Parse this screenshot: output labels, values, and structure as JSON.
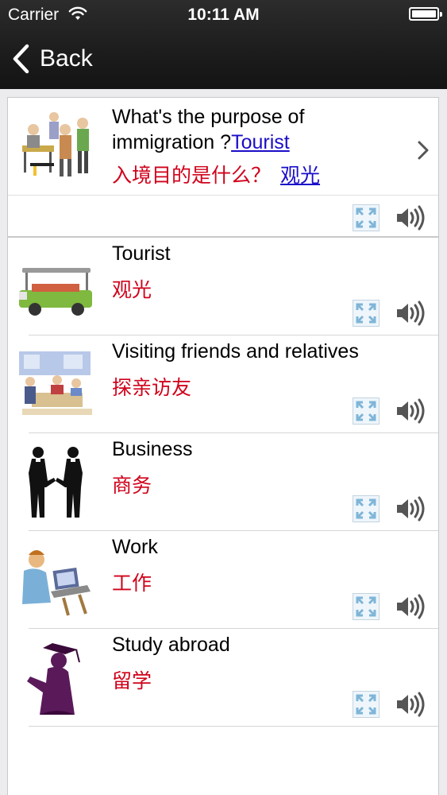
{
  "status_bar": {
    "carrier": "Carrier",
    "time": "10:11 AM"
  },
  "nav": {
    "back_label": "Back"
  },
  "header": {
    "question_en": "What's the purpose of immigration ?",
    "answer_en": "Tourist",
    "question_zh": "入境目的是什么？",
    "answer_zh": "观光"
  },
  "items": [
    {
      "en": "Tourist",
      "zh": "观光",
      "image": "tourist-bus-image"
    },
    {
      "en": "Visiting friends and relatives",
      "zh": "探亲访友",
      "image": "family-gathering-image"
    },
    {
      "en": "Business",
      "zh": "商务",
      "image": "handshake-image"
    },
    {
      "en": "Work",
      "zh": "工作",
      "image": "office-worker-image"
    },
    {
      "en": "Study abroad",
      "zh": "留学",
      "image": "graduate-image"
    }
  ],
  "colors": {
    "nav_bg": "#1c1c1c",
    "chinese_text": "#d0021b",
    "link": "#1a0ec8"
  }
}
